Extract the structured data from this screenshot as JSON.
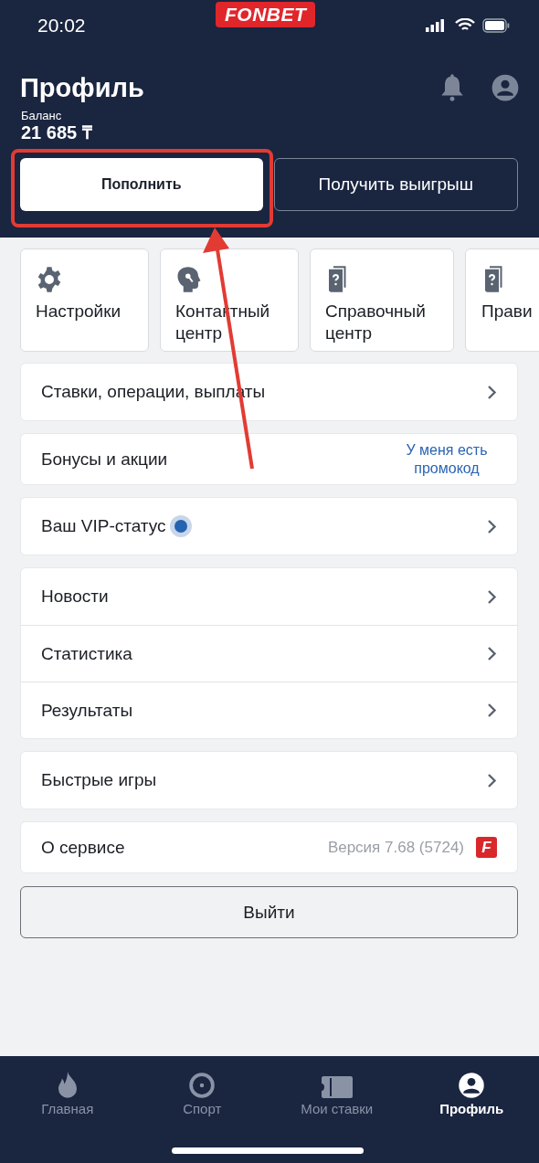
{
  "status_bar": {
    "time": "20:02",
    "logo": "FONBET"
  },
  "header": {
    "title": "Профиль",
    "balance_label": "Баланс",
    "balance": "21 685 ₸",
    "buttons": [
      {
        "label": "Пополнить",
        "kind": "primary"
      },
      {
        "label": "Получить выигрыш",
        "kind": "outline"
      }
    ]
  },
  "tiles": [
    {
      "label": "Настройки",
      "kind": "gear"
    },
    {
      "label": "Контактный центр",
      "kind": "head"
    },
    {
      "label": "Справочный центр",
      "kind": "book"
    },
    {
      "label": "Прави",
      "kind": "book"
    }
  ],
  "menu_groups": [
    [
      {
        "label": "Ставки, операции, выплаты",
        "kind": "chevron"
      }
    ],
    [
      {
        "label": "Бонусы и акции",
        "kind": "link",
        "link": "У меня есть промокод"
      }
    ],
    [
      {
        "label": "Ваш VIP-статус",
        "kind": "vip",
        "color": "#2563b0"
      }
    ],
    [
      {
        "label": "Новости",
        "kind": "chevron"
      },
      {
        "label": "Статистика",
        "kind": "chevron"
      },
      {
        "label": "Результаты",
        "kind": "chevron"
      }
    ],
    [
      {
        "label": "Быстрые игры",
        "kind": "chevron"
      }
    ],
    [
      {
        "label": "О сервисе",
        "kind": "version",
        "version": "Версия 7.68 (5724)",
        "badge": "F"
      }
    ]
  ],
  "logout": "Выйти",
  "bottom_nav": [
    {
      "label": "Главная",
      "kind": "flame",
      "selected": false
    },
    {
      "label": "Спорт",
      "kind": "target",
      "selected": false
    },
    {
      "label": "Мои ставки",
      "kind": "ticket",
      "selected": false
    },
    {
      "label": "Профиль",
      "kind": "person",
      "selected": true
    }
  ]
}
